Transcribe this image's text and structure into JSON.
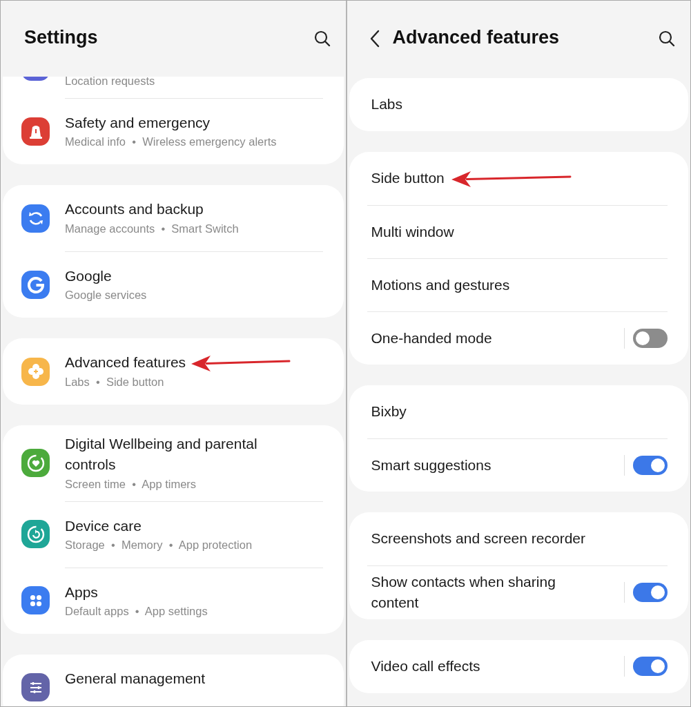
{
  "settings": {
    "title": "Settings",
    "partial_item": {
      "subtitle": "Location requests",
      "color": "#5b63d6"
    },
    "groups": [
      [
        {
          "kind": "siren",
          "color": "#dc3e35",
          "title": "Safety and emergency",
          "subtitle": "Medical info  •  Wireless emergency alerts",
          "pointed_at": false
        }
      ],
      [
        {
          "kind": "sync",
          "color": "#3b7cf0",
          "title": "Accounts and backup",
          "subtitle": "Manage accounts  •  Smart Switch",
          "pointed_at": false
        },
        {
          "kind": "letter",
          "color": "#3b7cf0",
          "title": "Google",
          "subtitle": "Google services",
          "pointed_at": false
        }
      ],
      [
        {
          "kind": "gear",
          "color": "#f7b64a",
          "title": "Advanced features",
          "subtitle": "Labs  •  Side button",
          "pointed_at": true
        }
      ],
      [
        {
          "kind": "heart",
          "color": "#4caa3c",
          "title": "Digital Wellbeing and parental controls",
          "subtitle": "Screen time  •  App timers",
          "pointed_at": false
        },
        {
          "kind": "care",
          "color": "#1fa697",
          "title": "Device care",
          "subtitle": "Storage  •  Memory  •  App protection",
          "pointed_at": false
        },
        {
          "kind": "apps",
          "color": "#3b7cf0",
          "title": "Apps",
          "subtitle": "Default apps  •  App settings",
          "pointed_at": false
        }
      ],
      [
        {
          "kind": "sliders",
          "color": "#6364a8",
          "title": "General management",
          "pointed_at": false
        }
      ]
    ]
  },
  "advanced": {
    "title": "Advanced features",
    "groups": [
      [
        {
          "kind": "plain",
          "label": "Labs",
          "pointed_at": false
        }
      ],
      [
        {
          "kind": "plain",
          "label": "Side button",
          "pointed_at": true
        },
        {
          "kind": "plain",
          "label": "Multi window",
          "pointed_at": false
        },
        {
          "kind": "plain",
          "label": "Motions and gestures",
          "pointed_at": false
        },
        {
          "kind": "toggle",
          "label": "One-handed mode",
          "on": false,
          "pointed_at": false
        }
      ],
      [
        {
          "kind": "plain",
          "label": "Bixby",
          "pointed_at": false
        },
        {
          "kind": "toggle",
          "label": "Smart suggestions",
          "on": true,
          "pointed_at": false
        }
      ],
      [
        {
          "kind": "plain",
          "label": "Screenshots and screen recorder",
          "pointed_at": false
        },
        {
          "kind": "toggle",
          "label": "Show contacts when sharing content",
          "on": true,
          "pointed_at": false
        }
      ],
      [
        {
          "kind": "toggle",
          "label": "Video call effects",
          "on": true,
          "pointed_at": false
        }
      ]
    ]
  }
}
